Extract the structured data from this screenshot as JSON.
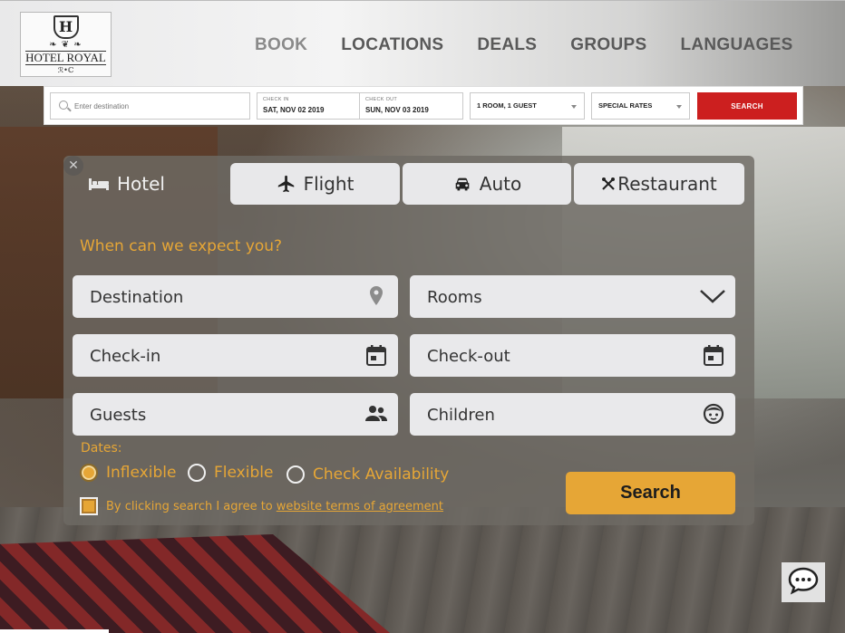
{
  "logo": {
    "letter": "H",
    "flourish": "❧ ❦ ❧",
    "name": "HOTEL ROYAL",
    "sub": "ℛ•ℂ"
  },
  "nav": {
    "items": [
      "BOOK",
      "LOCATIONS",
      "DEALS",
      "GROUPS",
      "LANGUAGES"
    ]
  },
  "bookbar": {
    "destination_placeholder": "Enter destination",
    "checkin_label": "CHECK IN",
    "checkin_value": "SAT, NOV 02 2019",
    "checkout_label": "CHECK OUT",
    "checkout_value": "SUN, NOV 03 2019",
    "rooms_value": "1 ROOM, 1 GUEST",
    "rates_value": "SPECIAL RATES",
    "search_label": "SEARCH"
  },
  "widget": {
    "close_glyph": "✕",
    "tabs": [
      {
        "label": "Hotel",
        "icon": "bed-icon",
        "active": true
      },
      {
        "label": "Flight",
        "icon": "airplane-icon",
        "active": false
      },
      {
        "label": "Auto",
        "icon": "car-icon",
        "active": false
      },
      {
        "label": "Restaurant",
        "icon": "utensils-icon",
        "active": false
      }
    ],
    "prompt": "When can we expect you?",
    "fields": {
      "destination": "Destination",
      "rooms": "Rooms",
      "checkin": "Check-in",
      "checkout": "Check-out",
      "guests": "Guests",
      "children": "Children"
    },
    "dates_label": "Dates:",
    "date_options": [
      {
        "label": "Inflexible",
        "selected": true
      },
      {
        "label": "Flexible",
        "selected": false
      },
      {
        "label": "Check Availability",
        "selected": false
      }
    ],
    "agree_text": "By clicking search I agree to",
    "agree_link": "website terms of agreement",
    "search_label": "Search"
  },
  "colors": {
    "accent": "#e6a636",
    "search_red": "#cc1f1f"
  }
}
